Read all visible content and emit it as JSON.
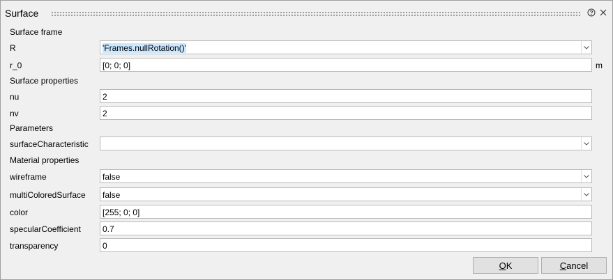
{
  "dialog": {
    "title": "Surface",
    "help_icon": "question-circle-icon",
    "close_icon": "close-icon"
  },
  "sections": {
    "surface_frame": "Surface frame",
    "surface_properties": "Surface properties",
    "parameters": "Parameters",
    "material_properties": "Material properties"
  },
  "fields": {
    "R": {
      "label": "R",
      "value": "'Frames.nullRotation()'"
    },
    "r_0": {
      "label": "r_0",
      "value": "[0; 0; 0]",
      "unit": "m"
    },
    "nu": {
      "label": "nu",
      "value": "2"
    },
    "nv": {
      "label": "nv",
      "value": "2"
    },
    "surfaceCharacteristic": {
      "label": "surfaceCharacteristic",
      "value": ""
    },
    "wireframe": {
      "label": "wireframe",
      "value": "false"
    },
    "multiColoredSurface": {
      "label": "multiColoredSurface",
      "value": "false"
    },
    "color": {
      "label": "color",
      "value": "[255; 0; 0]"
    },
    "specularCoefficient": {
      "label": "specularCoefficient",
      "value": "0.7"
    },
    "transparency": {
      "label": "transparency",
      "value": "0"
    }
  },
  "buttons": {
    "ok_label": "OK",
    "ok_mnemonic": "O",
    "ok_rest": "K",
    "cancel_label": "Cancel",
    "cancel_mnemonic": "C",
    "cancel_rest": "ancel"
  }
}
